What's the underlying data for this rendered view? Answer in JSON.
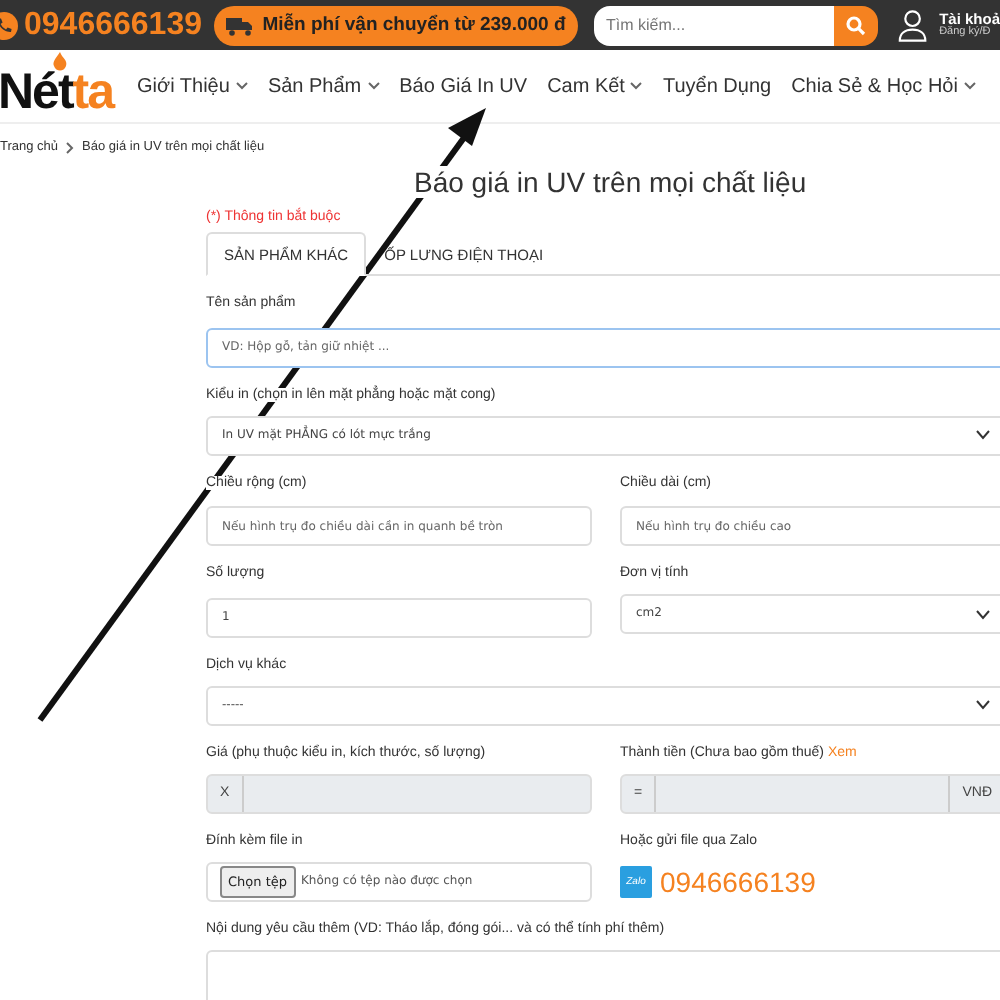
{
  "topbar": {
    "phone": "0946666139",
    "shipping": "Miễn phí vận chuyển từ 239.000 đ",
    "search": {
      "placeholder": "Tìm kiếm..."
    },
    "account": {
      "title": "Tài khoả",
      "subtitle": "Đăng ký/Đ"
    }
  },
  "nav": {
    "logo": {
      "main": "Nét",
      "accent": "ta"
    },
    "items": [
      {
        "label": "Giới Thiệu",
        "has_dropdown": true
      },
      {
        "label": "Sản Phẩm",
        "has_dropdown": true
      },
      {
        "label": "Báo Giá In UV",
        "has_dropdown": false
      },
      {
        "label": "Cam Kết",
        "has_dropdown": true
      },
      {
        "label": "Tuyển Dụng",
        "has_dropdown": false
      },
      {
        "label": "Chia Sẻ & Học Hỏi",
        "has_dropdown": true
      }
    ]
  },
  "breadcrumb": [
    "Trang chủ",
    "Báo giá in UV trên mọi chất liệu"
  ],
  "title": "Báo giá in UV trên mọi chất liệu",
  "required_note": "(*) Thông tin bắt buộc",
  "tabs": [
    {
      "label": "SẢN PHẨM KHÁC",
      "selected": true
    },
    {
      "label": "ỐP LƯNG ĐIỆN THOẠI",
      "selected": false
    }
  ],
  "rows": [
    {
      "fields": [
        {
          "kind": "text",
          "label": "Tên sản phẩm",
          "placeholder": "VD: Hộp gỗ, tản giữ nhiệt ...",
          "focused": true
        }
      ]
    },
    {
      "fields": [
        {
          "kind": "select",
          "label": "Kiểu in (chọn in lên mặt phẳng hoặc mặt cong)",
          "value": "In UV mặt PHẲNG có lót mực trắng"
        }
      ]
    },
    {
      "fields": [
        {
          "kind": "text",
          "label": "Chiều rộng (cm)",
          "placeholder": "Nếu hình trụ đo chiều dài cần in quanh bề tròn",
          "focused": false
        },
        {
          "kind": "text",
          "label": "Chiều dài (cm)",
          "placeholder": "Nếu hình trụ đo chiều cao",
          "focused": false
        }
      ]
    },
    {
      "fields": [
        {
          "kind": "text",
          "label": "Số lượng",
          "value": "1",
          "focused": false
        },
        {
          "kind": "select",
          "label": "Đơn vị tính",
          "value": "cm2"
        }
      ]
    },
    {
      "fields": [
        {
          "kind": "select",
          "label": "Dịch vụ khác",
          "value": "-----"
        }
      ]
    },
    {
      "fields": [
        {
          "kind": "addon",
          "label": "Giá (phụ thuộc kiểu in, kích thước, số lượng)",
          "prefix": "X"
        },
        {
          "kind": "addon",
          "label": "Thành tiền (Chưa bao gồm thuế)",
          "link": "Xem",
          "prefix": "=",
          "suffix": "VNĐ"
        }
      ]
    },
    {
      "fields": [
        {
          "kind": "file",
          "label": "Đính kèm file in",
          "button": "Chọn tệp",
          "status": "Không có tệp nào được chọn"
        },
        {
          "kind": "zalo",
          "label": "Hoặc gửi file qua Zalo",
          "badge": "Zalo",
          "phone": "0946666139"
        }
      ]
    },
    {
      "fields": [
        {
          "kind": "textarea",
          "label": "Nội dung yêu cầu thêm (VD: Tháo lắp, đóng gói... và có thể tính phí thêm)"
        }
      ]
    }
  ]
}
